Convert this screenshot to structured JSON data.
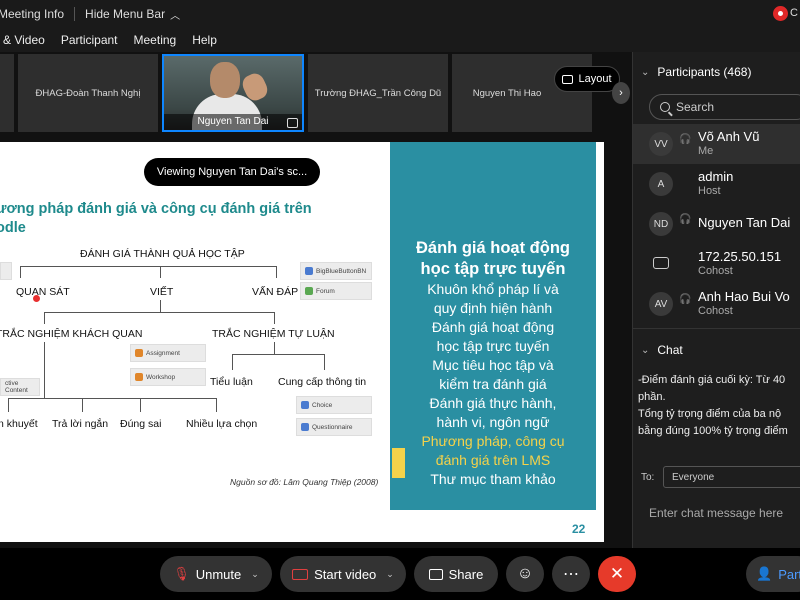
{
  "topbar": {
    "meeting_info": "Meeting Info",
    "hide_menu_bar": "Hide Menu Bar",
    "rec_letter": "C"
  },
  "menubar": {
    "items": [
      "& Video",
      "Participant",
      "Meeting",
      "Help"
    ]
  },
  "thumbnails": {
    "items": [
      "ĐHAG-Đoàn Thanh Nghị",
      "Nguyen Tan Dai",
      "Trường ĐHAG_Trần Công Dũ",
      "Nguyen Thi Hao"
    ],
    "layout_label": "Layout"
  },
  "slide": {
    "viewing": "Viewing Nguyen Tan Dai's sc...",
    "title_line1": "ương pháp đánh giá và công cụ đánh giá trên",
    "title_line2": "odle",
    "diagram": {
      "root": "ĐÁNH GIÁ THÀNH QUẢ HỌC TẬP",
      "level1": [
        "QUAN SÁT",
        "VIẾT",
        "VẤN ĐÁP"
      ],
      "level2": [
        "TRẮC NGHIỆM KHÁCH QUAN",
        "TRẮC NGHIỆM TỰ LUẬN"
      ],
      "level3a": [
        "Tiểu luận",
        "Cung cấp thông tin"
      ],
      "level3b": [
        "n khuyết",
        "Trả lời ngắn",
        "Đúng sai",
        "Nhiều lựa chọn"
      ],
      "mini_cards": [
        "BigBlueButtonBN",
        "Forum",
        "Assignment",
        "Workshop",
        "Choice",
        "Questionnaire",
        "ctive Content"
      ]
    },
    "source": "Nguồn sơ đồ: Lâm Quang Thiệp (2008)",
    "panel": {
      "heading1": "Đánh giá hoạt động",
      "heading2": "học tập trực tuyến",
      "items": [
        "Khuôn khổ pháp lí và",
        "quy định hiện hành",
        "Đánh giá hoạt động",
        "học tập trực tuyến",
        "Mục tiêu học tập và",
        "kiểm tra đánh giá",
        "Đánh giá thực hành,",
        "hành vi, ngôn ngữ"
      ],
      "highlight1": "Phương pháp, công cụ",
      "highlight2": "đánh giá trên LMS",
      "last": "Thư mục tham khảo"
    },
    "page_number": "22"
  },
  "participants": {
    "header": "Participants (468)",
    "search_placeholder": "Search",
    "rows": [
      {
        "initials": "VV",
        "name": "Võ Anh Vũ",
        "role": "Me"
      },
      {
        "initials": "A",
        "name": "admin",
        "role": "Host"
      },
      {
        "initials": "ND",
        "name": "Nguyen Tan Dai",
        "role": ""
      },
      {
        "initials": "",
        "name": "172.25.50.151",
        "role": "Cohost"
      },
      {
        "initials": "AV",
        "name": "Anh Hao Bui Vo",
        "role": "Cohost"
      }
    ]
  },
  "chat": {
    "header": "Chat",
    "lines": [
      "-Điểm đánh giá cuối kỳ: Từ 40",
      "phần.",
      "Tổng tỷ trọng điểm của ba nộ",
      "bằng đúng 100% tỷ trọng điểm"
    ],
    "to_label": "To:",
    "to_value": "Everyone",
    "input_placeholder": "Enter chat message here"
  },
  "toolbar": {
    "unmute": "Unmute",
    "start_video": "Start video",
    "share": "Share",
    "participants": "Part"
  }
}
